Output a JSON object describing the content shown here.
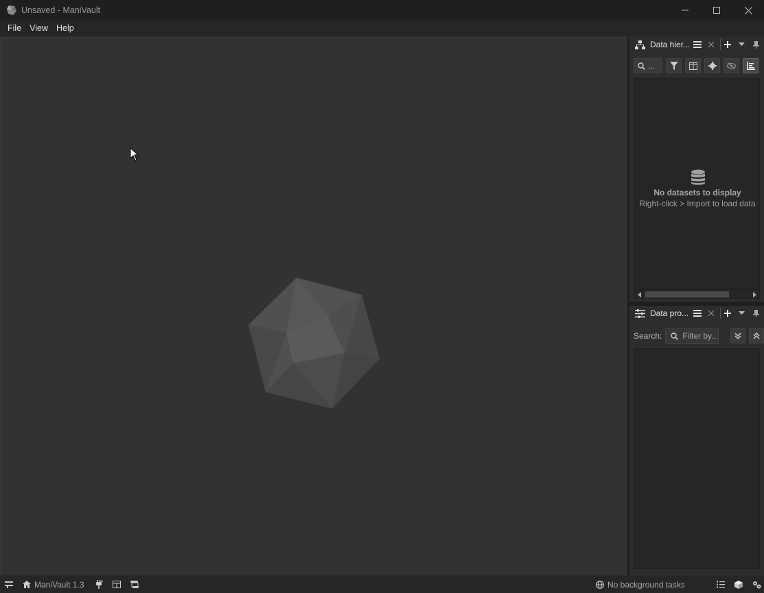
{
  "window": {
    "title": "Unsaved - ManiVault"
  },
  "menubar": {
    "items": [
      "File",
      "View",
      "Help"
    ]
  },
  "data_hierarchy": {
    "title": "Data hier...",
    "search_placeholder": "...",
    "empty_title": "No datasets to display",
    "empty_subtitle": "Right-click > Import to load data"
  },
  "data_properties": {
    "title": "Data pro...",
    "search_label": "Search:",
    "filter_placeholder": "Filter by..."
  },
  "statusbar": {
    "app_label": "ManiVault 1.3",
    "tasks_label": "No background tasks"
  },
  "colors": {
    "background": "#323232",
    "panel": "#2d2d2d",
    "titlebar": "#1f1f1f"
  }
}
